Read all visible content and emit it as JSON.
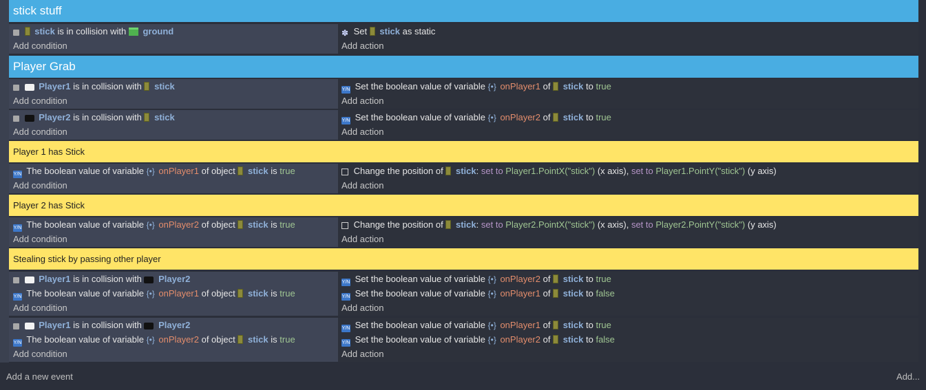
{
  "groups": {
    "g1": "stick stuff",
    "g2": "Player Grab"
  },
  "comments": {
    "c1": "Player 1 has Stick",
    "c2": "Player 2 has Stick",
    "c3": "Stealing stick by passing other player"
  },
  "common": {
    "add_condition": "Add condition",
    "add_action": "Add action",
    "is_in_collision_with": "is in collision with",
    "set_bool_var": "Set the boolean value of variable",
    "of": "of",
    "to": "to",
    "true": "true",
    "false": "false",
    "bool_value_of_var": "The boolean value of variable",
    "of_object": "of object",
    "is": "is",
    "change_pos": "Change the position of",
    "set_to": "set to",
    "x_axis": "(x axis),",
    "y_axis": "(y axis)",
    "colon": ":",
    "set": "Set",
    "as_static": "as static",
    "comma_set_to": "set to"
  },
  "objects": {
    "stick": "stick",
    "ground": "ground",
    "player1": "Player1",
    "player2": "Player2"
  },
  "vars": {
    "onPlayer1": "onPlayer1",
    "onPlayer2": "onPlayer2"
  },
  "expr": {
    "p1x": "Player1.PointX(\"stick\")",
    "p1y": "Player1.PointY(\"stick\")",
    "p2x": "Player2.PointX(\"stick\")",
    "p2y": "Player2.PointY(\"stick\")"
  },
  "footer": {
    "add_event": "Add a new event",
    "add_more": "Add..."
  },
  "icons": {
    "condition": "condition-icon",
    "variable": "variable-icon",
    "object_stick": "stick-object-icon",
    "object_ground": "ground-object-icon",
    "object_player1": "player1-object-icon",
    "object_player2": "player2-object-icon",
    "static": "gear-icon",
    "position": "position-box-icon"
  },
  "colors": {
    "group_header": "#49ade2",
    "comment": "#ffe467",
    "condition_bg": "#3f4556",
    "action_bg": "#2d313b",
    "object_name": "#8fb0d8",
    "variable_name": "#e38d6c",
    "value_literal": "#9fc592"
  }
}
